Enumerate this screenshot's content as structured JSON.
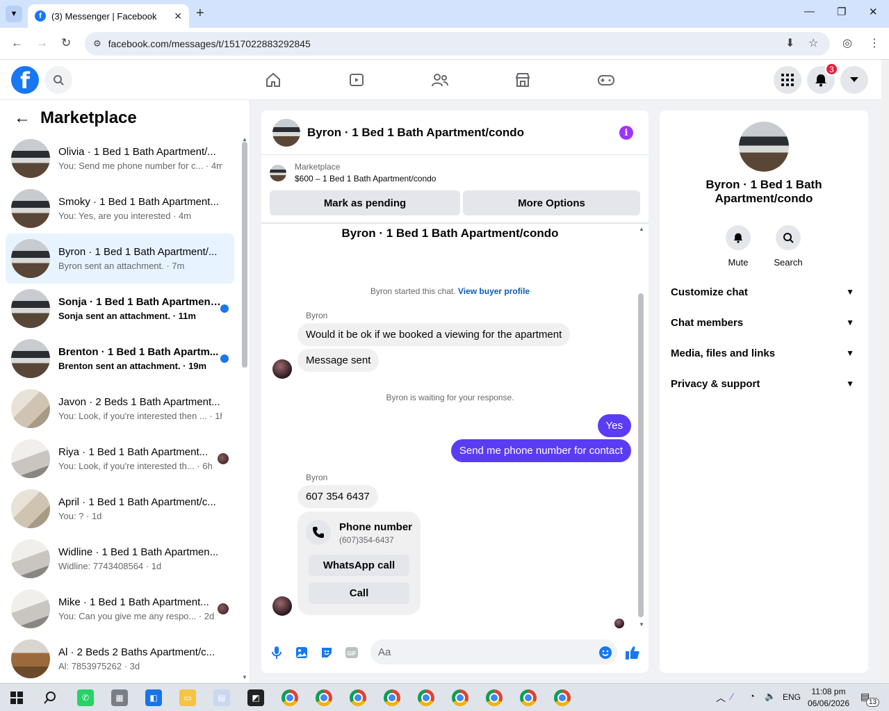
{
  "browser": {
    "tab_title": "(3) Messenger | Facebook",
    "url": "facebook.com/messages/t/1517022883292845"
  },
  "fbnav": {
    "notification_count": "3"
  },
  "left": {
    "title": "Marketplace",
    "conversations": [
      {
        "name": "Olivia · 1 Bed 1 Bath Apartment/...",
        "sub": "You: Send me phone number for c... · 4m"
      },
      {
        "name": "Smoky · 1 Bed 1 Bath Apartment...",
        "sub": "You: Yes, are you interested · 4m"
      },
      {
        "name": "Byron · 1 Bed 1 Bath Apartment/...",
        "sub": "Byron sent an attachment. · 7m"
      },
      {
        "name": "Sonja · 1 Bed 1 Bath Apartment...",
        "sub": "Sonja sent an attachment. · 11m"
      },
      {
        "name": "Brenton · 1 Bed 1 Bath Apartm...",
        "sub": "Brenton sent an attachment. · 19m"
      },
      {
        "name": "Javon · 2 Beds 1 Bath Apartment...",
        "sub": "You: Look, if you're interested then ... · 1h"
      },
      {
        "name": "Riya · 1 Bed 1 Bath Apartment...",
        "sub": "You: Look, if you're interested th... · 6h"
      },
      {
        "name": "April · 1 Bed 1 Bath Apartment/c...",
        "sub": "You: ? · 1d"
      },
      {
        "name": "Widline · 1 Bed 1 Bath Apartmen...",
        "sub": "Widline: 7743408564 · 1d"
      },
      {
        "name": "Mike · 1 Bed 1 Bath Apartment...",
        "sub": "You: Can you give me any respo... · 2d"
      },
      {
        "name": "Al · 2 Beds 2 Baths Apartment/c...",
        "sub": "Al: 7853975262 · 3d"
      }
    ]
  },
  "chat": {
    "header_title": "Byron · 1 Bed 1 Bath Apartment/condo",
    "marketplace_label": "Marketplace",
    "listing": "$600 – 1 Bed 1 Bath Apartment/condo",
    "btn_pending": "Mark as pending",
    "btn_more": "More Options",
    "body_title": "Byron · 1 Bed 1 Bath Apartment/condo",
    "started_text": "Byron started this chat.",
    "view_profile": "View buyer profile",
    "sender": "Byron",
    "msg1": "Would it be ok if we booked a viewing for the apartment",
    "msg2": "Message sent",
    "waiting": "Byron is waiting for your response.",
    "out1": "Yes",
    "out2": "Send me phone number for contact",
    "msg3": "607 354 6437",
    "card_title": "Phone number",
    "card_number": "(607)354-6437",
    "card_whatsapp": "WhatsApp call",
    "card_call": "Call",
    "composer_placeholder": "Aa",
    "gif_label": "GIF"
  },
  "right": {
    "name": "Byron · 1 Bed 1 Bath Apartment/condo",
    "mute": "Mute",
    "search": "Search",
    "sections": [
      "Customize chat",
      "Chat members",
      "Media, files and links",
      "Privacy & support"
    ]
  },
  "taskbar": {
    "lang": "ENG",
    "time": "11:08 pm",
    "date": "06/06/2026",
    "notif": "13"
  },
  "colors": {
    "fb_blue": "#1877f2",
    "outgoing_bubble": "#5b3cf5",
    "unread_dot": "#1877f2",
    "info_purple": "#a033ff"
  }
}
